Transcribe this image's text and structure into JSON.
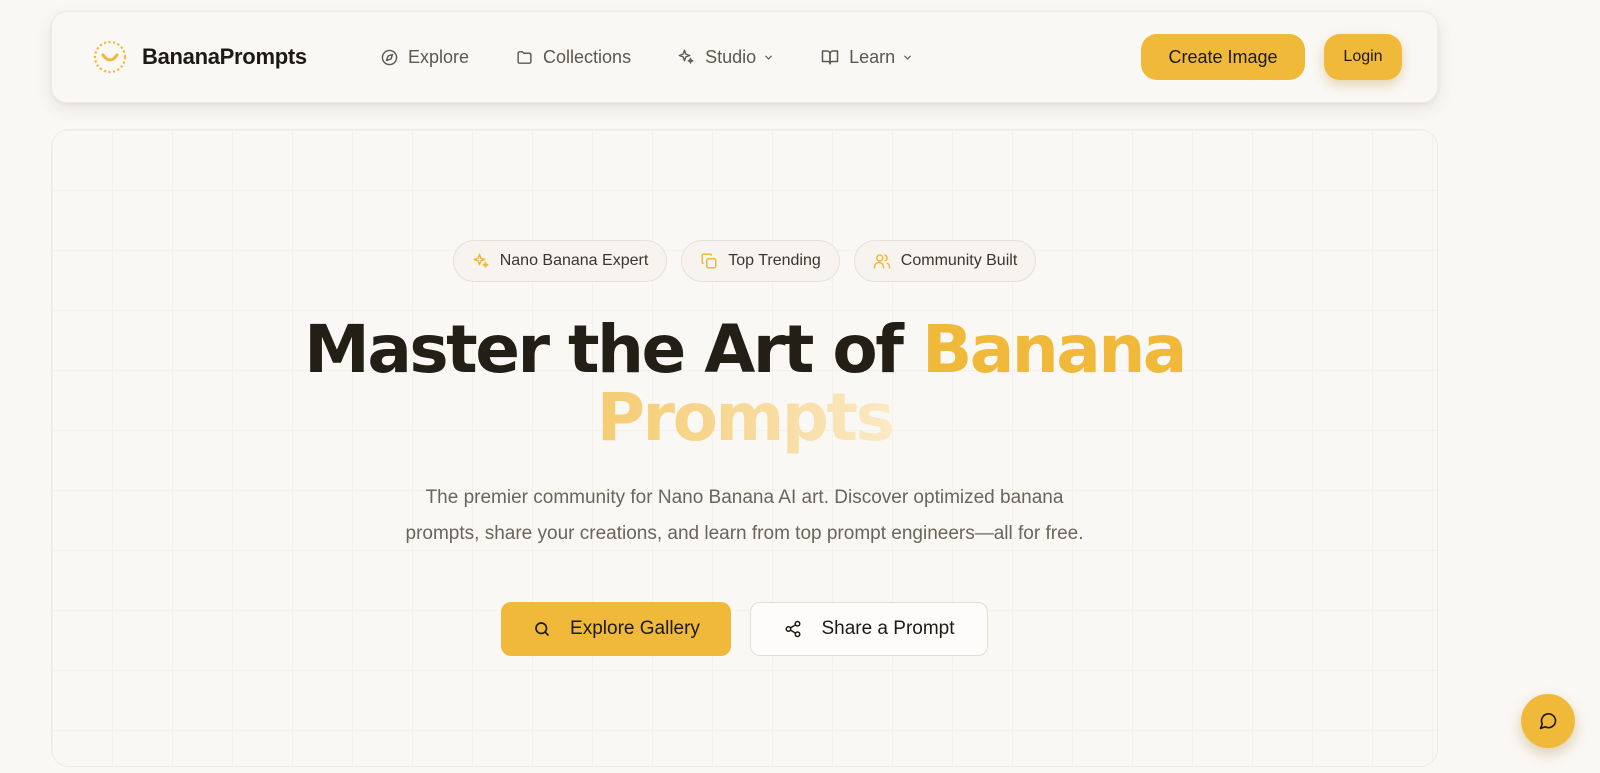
{
  "colors": {
    "accent": "#f0b93a",
    "background": "#faf8f5",
    "text": "#221f18",
    "muted": "#6b6559"
  },
  "brand": {
    "name": "BananaPrompts",
    "logo_icon": "banana-smile-logo-icon"
  },
  "nav": {
    "links": [
      {
        "label": "Explore",
        "icon": "compass-icon"
      },
      {
        "label": "Collections",
        "icon": "folder-icon"
      },
      {
        "label": "Studio",
        "icon": "sparkles-icon",
        "dropdown": true
      },
      {
        "label": "Learn",
        "icon": "book-open-icon",
        "dropdown": true
      }
    ],
    "create_label": "Create Image",
    "login_label": "Login"
  },
  "hero": {
    "badges": [
      {
        "label": "Nano Banana Expert",
        "icon": "sparkles-icon"
      },
      {
        "label": "Top Trending",
        "icon": "copy-icon"
      },
      {
        "label": "Community Built",
        "icon": "users-icon"
      }
    ],
    "title_part1": "Master the Art of ",
    "title_highlight1": "Banana",
    "title_highlight2": "Prompts",
    "subtitle_line1": "The premier community for Nano Banana AI art. Discover optimized banana",
    "subtitle_line2": "prompts, share your creations, and learn from top prompt engineers—all for free.",
    "explore_label": "Explore Gallery",
    "share_label": "Share a Prompt"
  },
  "chat": {
    "icon": "chat-bubble-icon"
  }
}
